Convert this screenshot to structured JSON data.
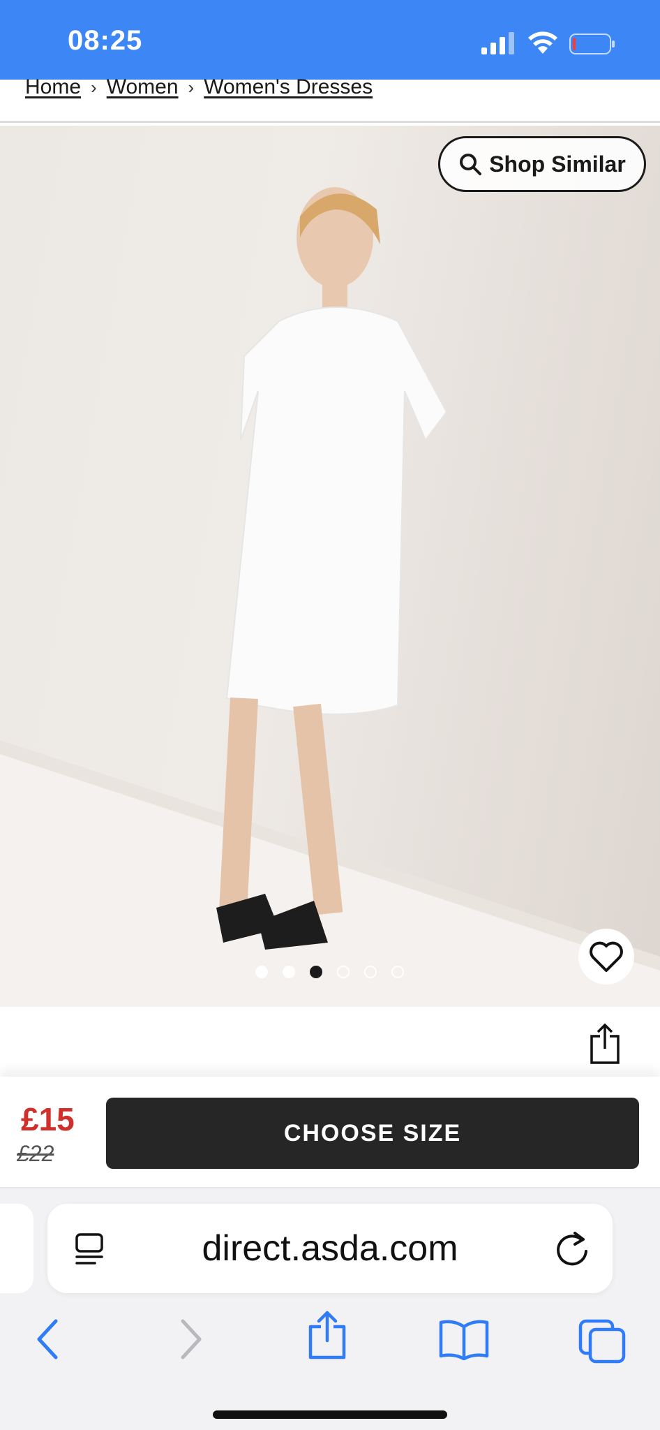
{
  "status_bar": {
    "time": "08:25",
    "icons": [
      "signal-icon",
      "wifi-icon",
      "battery-icon"
    ]
  },
  "breadcrumb": {
    "items": [
      {
        "label": "Home"
      },
      {
        "label": "Women"
      },
      {
        "label": "Women's Dresses"
      }
    ]
  },
  "gallery": {
    "shop_similar_label": "Shop Similar",
    "image_count": 6,
    "active_index": 3,
    "favorite_icon": "heart-outline-icon"
  },
  "price": {
    "current": "£15",
    "was": "£22",
    "current_color": "#d0302b"
  },
  "actions": {
    "choose_size_label": "CHOOSE SIZE"
  },
  "browser": {
    "url": "direct.asda.com",
    "accent_color": "#3c86f5"
  },
  "colors": {
    "status_bar": "#3c86f5",
    "button_dark": "#262626"
  }
}
